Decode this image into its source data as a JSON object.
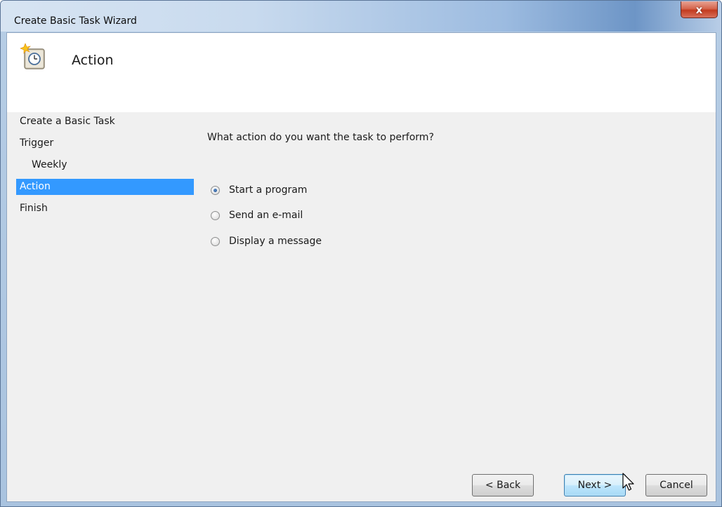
{
  "window": {
    "title": "Create Basic Task Wizard",
    "close_symbol": "x"
  },
  "header": {
    "title": "Action",
    "icon": "task-scheduler-clock-icon"
  },
  "nav": {
    "items": [
      {
        "label": "Create a Basic Task",
        "active": false
      },
      {
        "label": "Trigger",
        "active": false
      },
      {
        "label": "Weekly",
        "active": false
      },
      {
        "label": "Action",
        "active": true
      },
      {
        "label": "Finish",
        "active": false
      }
    ]
  },
  "main": {
    "question": "What action do you want the task to perform?",
    "options": [
      {
        "label": "Start a program",
        "selected": true
      },
      {
        "label": "Send an e-mail",
        "selected": false
      },
      {
        "label": "Display a message",
        "selected": false
      }
    ]
  },
  "buttons": {
    "back": "< Back",
    "next": "Next >",
    "cancel": "Cancel"
  },
  "colors": {
    "selection": "#3399ff",
    "client_bg": "#f0f0f0",
    "close_button": "#c23b1f"
  }
}
